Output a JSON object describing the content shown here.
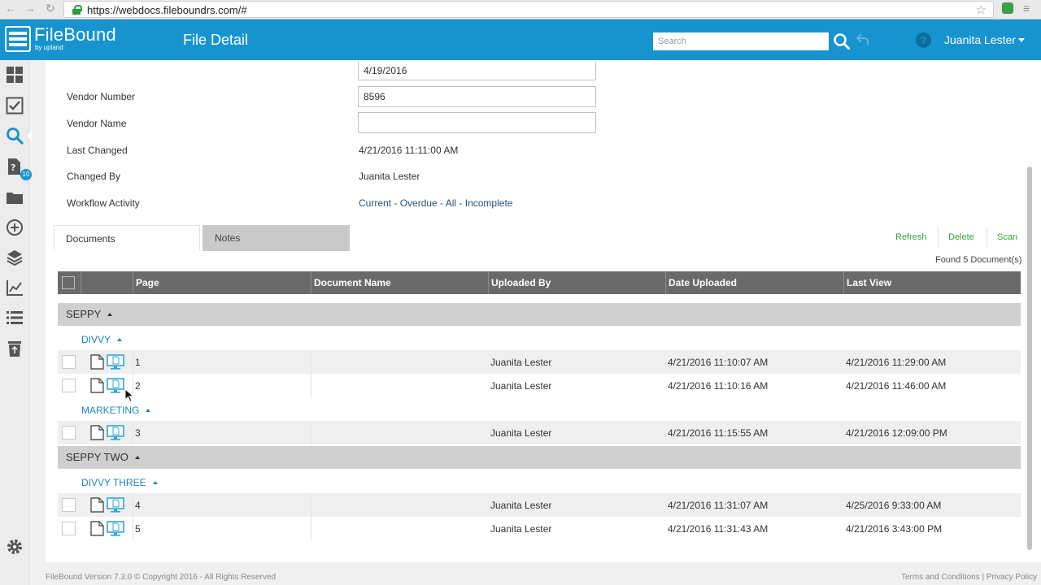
{
  "browser": {
    "url": "https://webdocs.fileboundrs.com/#"
  },
  "header": {
    "logo_text": "FileBound",
    "logo_sub": "by upland",
    "title": "File Detail",
    "search_placeholder": "Search",
    "user_name": "Juanita Lester",
    "help_glyph": "?"
  },
  "sidebar": {
    "items": [
      {
        "name": "dashboard-icon"
      },
      {
        "name": "tasks-check-icon"
      },
      {
        "name": "search-icon",
        "active": true
      },
      {
        "name": "unassigned-doc-icon",
        "badge": "10"
      },
      {
        "name": "folder-icon"
      },
      {
        "name": "add-circle-icon"
      },
      {
        "name": "layers-icon"
      },
      {
        "name": "reports-chart-icon"
      },
      {
        "name": "list-icon"
      },
      {
        "name": "recycle-bin-icon"
      }
    ],
    "settings_icon": "gear-icon"
  },
  "fields": {
    "top_partial_value": "4/19/2016",
    "vendor_number_label": "Vendor Number",
    "vendor_number_value": "8596",
    "vendor_name_label": "Vendor Name",
    "vendor_name_value": "",
    "last_changed_label": "Last Changed",
    "last_changed_value": "4/21/2016 11:11:00 AM",
    "changed_by_label": "Changed By",
    "changed_by_value": "Juanita Lester",
    "workflow_label": "Workflow Activity",
    "workflow_links": [
      "Current",
      "Overdue",
      "All",
      "Incomplete"
    ],
    "workflow_sep": " - "
  },
  "tabs": {
    "documents": "Documents",
    "notes": "Notes"
  },
  "actions": {
    "refresh": "Refresh",
    "delete": "Delete",
    "scan": "Scan",
    "found": "Found 5 Document(s)"
  },
  "grid": {
    "columns": [
      "Page",
      "Document Name",
      "Uploaded By",
      "Date Uploaded",
      "Last View"
    ],
    "groups": [
      {
        "name": "SEPPY",
        "subgroups": [
          {
            "name": "DIVVY",
            "rows": [
              {
                "page": "1",
                "document_name": "",
                "uploaded_by": "Juanita Lester",
                "date_uploaded": "4/21/2016 11:10:07 AM",
                "last_view": "4/21/2016 11:29:00 AM"
              },
              {
                "page": "2",
                "document_name": "",
                "uploaded_by": "Juanita Lester",
                "date_uploaded": "4/21/2016 11:10:16 AM",
                "last_view": "4/21/2016 11:46:00 AM"
              }
            ]
          },
          {
            "name": "MARKETING",
            "rows": [
              {
                "page": "3",
                "document_name": "",
                "uploaded_by": "Juanita Lester",
                "date_uploaded": "4/21/2016 11:15:55 AM",
                "last_view": "4/21/2016 12:09:00 PM"
              }
            ]
          }
        ]
      },
      {
        "name": "SEPPY TWO",
        "subgroups": [
          {
            "name": "DIVVY THREE",
            "rows": [
              {
                "page": "4",
                "document_name": "",
                "uploaded_by": "Juanita Lester",
                "date_uploaded": "4/21/2016 11:31:07 AM",
                "last_view": "4/25/2016 9:33:00 AM"
              },
              {
                "page": "5",
                "document_name": "",
                "uploaded_by": "Juanita Lester",
                "date_uploaded": "4/21/2016 11:31:43 AM",
                "last_view": "4/21/2016 3:43:00 PM"
              }
            ]
          }
        ]
      }
    ]
  },
  "footer": {
    "copyright": "FileBound Version 7.3.0 © Copyright 2016 - All Rights Reserved",
    "terms": "Terms and Conditions",
    "sep": " | ",
    "privacy": "Privacy Policy"
  },
  "colors": {
    "brand_blue": "#1794cf",
    "link_green": "#35a33a",
    "grid_header": "#6a6a6a",
    "group_row": "#cfcfcf"
  }
}
